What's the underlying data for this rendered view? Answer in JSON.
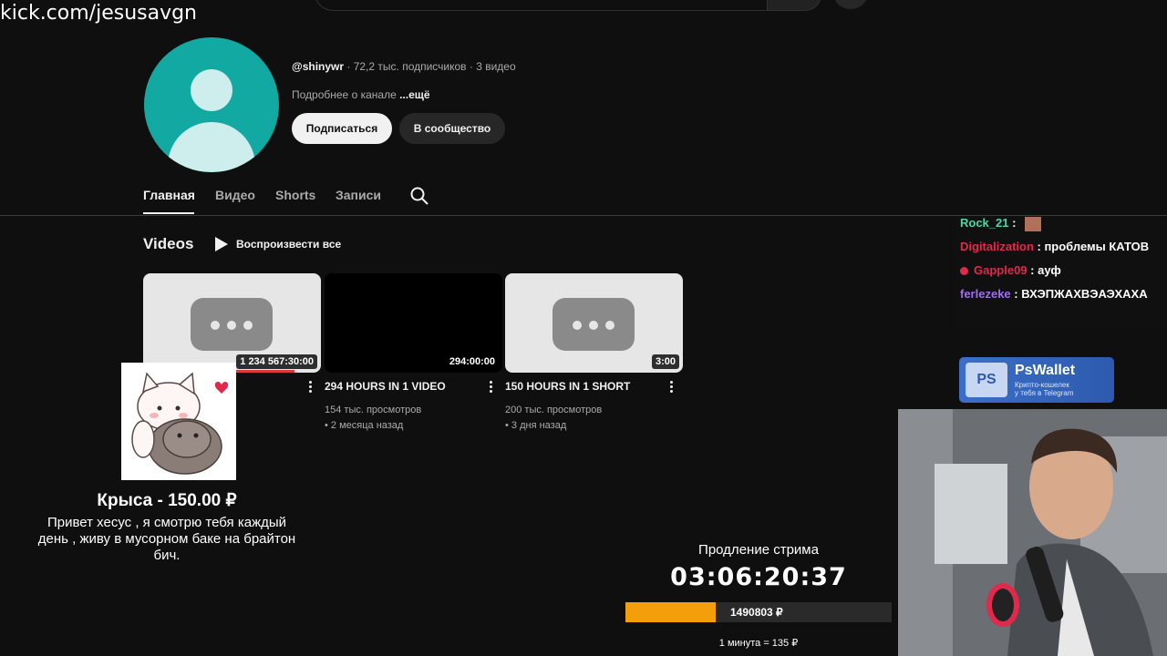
{
  "watermark": "kick.com/jesusavgn",
  "channel": {
    "handle": "@shinywr",
    "stats": " · 72,2 тыс. подписчиков · 3 видео",
    "about": "Подробнее о канале",
    "about_more": "...ещё",
    "subscribe_label": "Подписаться",
    "community_label": "В сообщество"
  },
  "tabs": [
    {
      "label": "Главная",
      "active": true
    },
    {
      "label": "Видео"
    },
    {
      "label": "Shorts"
    },
    {
      "label": "Записи"
    }
  ],
  "section": {
    "title": "Videos",
    "play_all": "Воспроизвести все"
  },
  "videos": [
    {
      "duration": "1 234 567:30:00",
      "title": "",
      "views": "",
      "age": "",
      "watched_fraction": 0.85
    },
    {
      "duration": "294:00:00",
      "title": "294 HOURS IN 1 VIDEO",
      "views": "154 тыс. просмотров",
      "age": "• 2 месяца назад"
    },
    {
      "duration": "3:00",
      "title": "150 HOURS IN 1 SHORT",
      "views": "200 тыс. просмотров",
      "age": "• 3 дня назад"
    }
  ],
  "chat": [
    {
      "user": "Rock_21",
      "sep": " :",
      "text": "",
      "color": "#4fd6a5"
    },
    {
      "user": "Digitalization",
      "sep": " : ",
      "text": "проблемы КАТОВ",
      "color": "#e0294b"
    },
    {
      "user": "Gapple09",
      "sep": " : ",
      "text": "ауф",
      "color": "#e0294b"
    },
    {
      "user": "ferlezeke",
      "sep": " : ",
      "text": "ВХЭПЖАХВЭАЭХАХА",
      "color": "#a06cf0"
    }
  ],
  "wallet": {
    "badge": "PS",
    "name": "PsWallet",
    "line1": "Крипто-кошелек",
    "line2": "у тебя в Telegram"
  },
  "donation": {
    "name": "Крыса - 150.00 ₽",
    "message": "Привет хесус , я смотрю тебя каждый день , живу в мусорном баке на брайтон бич."
  },
  "extension": {
    "label": "Продление стрима",
    "timer": "03:06:20:37",
    "amount": "1490803 ₽",
    "progress": 0.34,
    "rate": "1 минута = 135 ₽"
  },
  "colors": {
    "avatar_bg": "#13a9a3",
    "progress_orange": "#f59e0b",
    "wallet_blue": "#3b6fc9"
  }
}
